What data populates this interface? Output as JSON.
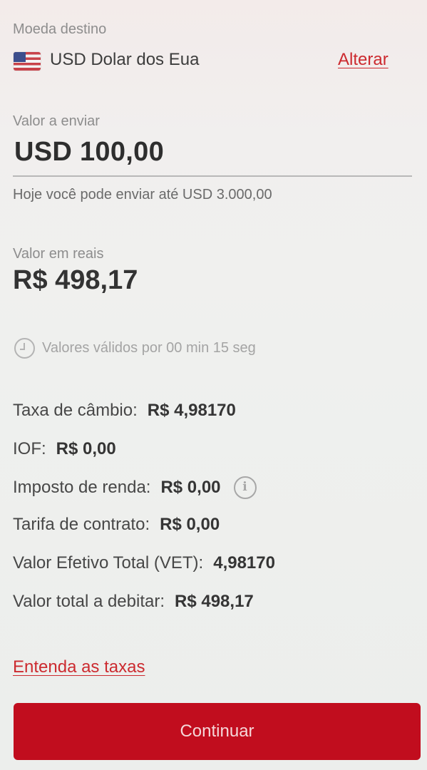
{
  "destination": {
    "label": "Moeda destino",
    "currency": "USD Dolar dos Eua",
    "flag_icon": "us-flag-icon",
    "change_label": "Alterar"
  },
  "send": {
    "label": "Valor a enviar",
    "value": "USD 100,00",
    "limit_text": "Hoje você pode enviar até USD 3.000,00"
  },
  "reais": {
    "label": "Valor em reais",
    "value": "R$ 498,17"
  },
  "validity": {
    "icon": "clock-icon",
    "text": "Valores válidos por 00 min 15 seg"
  },
  "details": [
    {
      "label": "Taxa de câmbio:",
      "value": "R$ 4,98170"
    },
    {
      "label": "IOF:",
      "value": "R$ 0,00"
    },
    {
      "label": "Imposto de renda:",
      "value": "R$ 0,00",
      "info_icon": "info-icon"
    },
    {
      "label": "Tarifa de contrato:",
      "value": "R$ 0,00"
    },
    {
      "label": "Valor Efetivo Total (VET):",
      "value": "4,98170"
    },
    {
      "label": "Valor total a debitar:",
      "value": "R$ 498,17"
    }
  ],
  "info_glyph": "i",
  "taxes_link": "Entenda as taxas",
  "continue_label": "Continuar",
  "colors": {
    "accent": "#c10d1e",
    "link": "#cc2a2f"
  }
}
